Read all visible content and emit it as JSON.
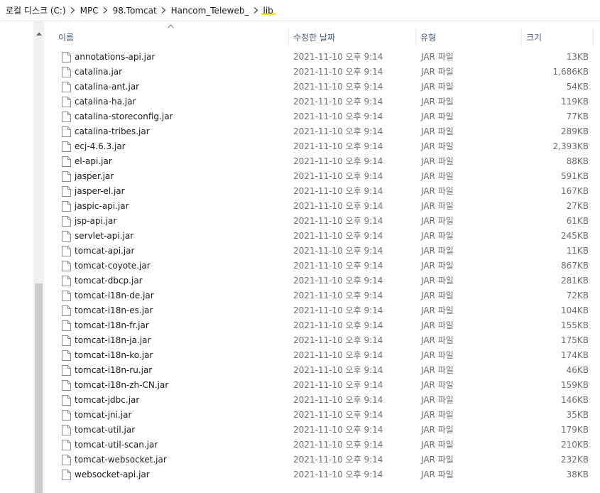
{
  "address": {
    "crumbs": [
      "로컬 디스크 (C:)",
      "MPC",
      "98.Tomcat",
      "Hancom_Teleweb_",
      "lib"
    ],
    "highlight_color": "#f2ec2a"
  },
  "columns": {
    "name": "이름",
    "date": "수정한 날짜",
    "type": "유형",
    "size": "크기"
  },
  "files": [
    {
      "name": "annotations-api.jar",
      "date": "2021-11-10 오후 9:14",
      "type": "JAR 파일",
      "size": "13KB"
    },
    {
      "name": "catalina.jar",
      "date": "2021-11-10 오후 9:14",
      "type": "JAR 파일",
      "size": "1,686KB"
    },
    {
      "name": "catalina-ant.jar",
      "date": "2021-11-10 오후 9:14",
      "type": "JAR 파일",
      "size": "54KB"
    },
    {
      "name": "catalina-ha.jar",
      "date": "2021-11-10 오후 9:14",
      "type": "JAR 파일",
      "size": "119KB"
    },
    {
      "name": "catalina-storeconfig.jar",
      "date": "2021-11-10 오후 9:14",
      "type": "JAR 파일",
      "size": "77KB"
    },
    {
      "name": "catalina-tribes.jar",
      "date": "2021-11-10 오후 9:14",
      "type": "JAR 파일",
      "size": "289KB"
    },
    {
      "name": "ecj-4.6.3.jar",
      "date": "2021-11-10 오후 9:14",
      "type": "JAR 파일",
      "size": "2,393KB"
    },
    {
      "name": "el-api.jar",
      "date": "2021-11-10 오후 9:14",
      "type": "JAR 파일",
      "size": "88KB"
    },
    {
      "name": "jasper.jar",
      "date": "2021-11-10 오후 9:14",
      "type": "JAR 파일",
      "size": "591KB"
    },
    {
      "name": "jasper-el.jar",
      "date": "2021-11-10 오후 9:14",
      "type": "JAR 파일",
      "size": "167KB"
    },
    {
      "name": "jaspic-api.jar",
      "date": "2021-11-10 오후 9:14",
      "type": "JAR 파일",
      "size": "27KB"
    },
    {
      "name": "jsp-api.jar",
      "date": "2021-11-10 오후 9:14",
      "type": "JAR 파일",
      "size": "61KB"
    },
    {
      "name": "servlet-api.jar",
      "date": "2021-11-10 오후 9:14",
      "type": "JAR 파일",
      "size": "245KB"
    },
    {
      "name": "tomcat-api.jar",
      "date": "2021-11-10 오후 9:14",
      "type": "JAR 파일",
      "size": "11KB"
    },
    {
      "name": "tomcat-coyote.jar",
      "date": "2021-11-10 오후 9:14",
      "type": "JAR 파일",
      "size": "867KB"
    },
    {
      "name": "tomcat-dbcp.jar",
      "date": "2021-11-10 오후 9:14",
      "type": "JAR 파일",
      "size": "281KB"
    },
    {
      "name": "tomcat-i18n-de.jar",
      "date": "2021-11-10 오후 9:14",
      "type": "JAR 파일",
      "size": "72KB"
    },
    {
      "name": "tomcat-i18n-es.jar",
      "date": "2021-11-10 오후 9:14",
      "type": "JAR 파일",
      "size": "104KB"
    },
    {
      "name": "tomcat-i18n-fr.jar",
      "date": "2021-11-10 오후 9:14",
      "type": "JAR 파일",
      "size": "155KB"
    },
    {
      "name": "tomcat-i18n-ja.jar",
      "date": "2021-11-10 오후 9:14",
      "type": "JAR 파일",
      "size": "175KB"
    },
    {
      "name": "tomcat-i18n-ko.jar",
      "date": "2021-11-10 오후 9:14",
      "type": "JAR 파일",
      "size": "174KB"
    },
    {
      "name": "tomcat-i18n-ru.jar",
      "date": "2021-11-10 오후 9:14",
      "type": "JAR 파일",
      "size": "46KB"
    },
    {
      "name": "tomcat-i18n-zh-CN.jar",
      "date": "2021-11-10 오후 9:14",
      "type": "JAR 파일",
      "size": "159KB"
    },
    {
      "name": "tomcat-jdbc.jar",
      "date": "2021-11-10 오후 9:14",
      "type": "JAR 파일",
      "size": "146KB"
    },
    {
      "name": "tomcat-jni.jar",
      "date": "2021-11-10 오후 9:14",
      "type": "JAR 파일",
      "size": "35KB"
    },
    {
      "name": "tomcat-util.jar",
      "date": "2021-11-10 오후 9:14",
      "type": "JAR 파일",
      "size": "179KB"
    },
    {
      "name": "tomcat-util-scan.jar",
      "date": "2021-11-10 오후 9:14",
      "type": "JAR 파일",
      "size": "210KB"
    },
    {
      "name": "tomcat-websocket.jar",
      "date": "2021-11-10 오후 9:14",
      "type": "JAR 파일",
      "size": "232KB"
    },
    {
      "name": "websocket-api.jar",
      "date": "2021-11-10 오후 9:14",
      "type": "JAR 파일",
      "size": "38KB"
    }
  ],
  "icons": {
    "file": "file-icon",
    "breadcrumb_separator": "chevron-right-icon",
    "sort": "sort-ascending-icon"
  }
}
